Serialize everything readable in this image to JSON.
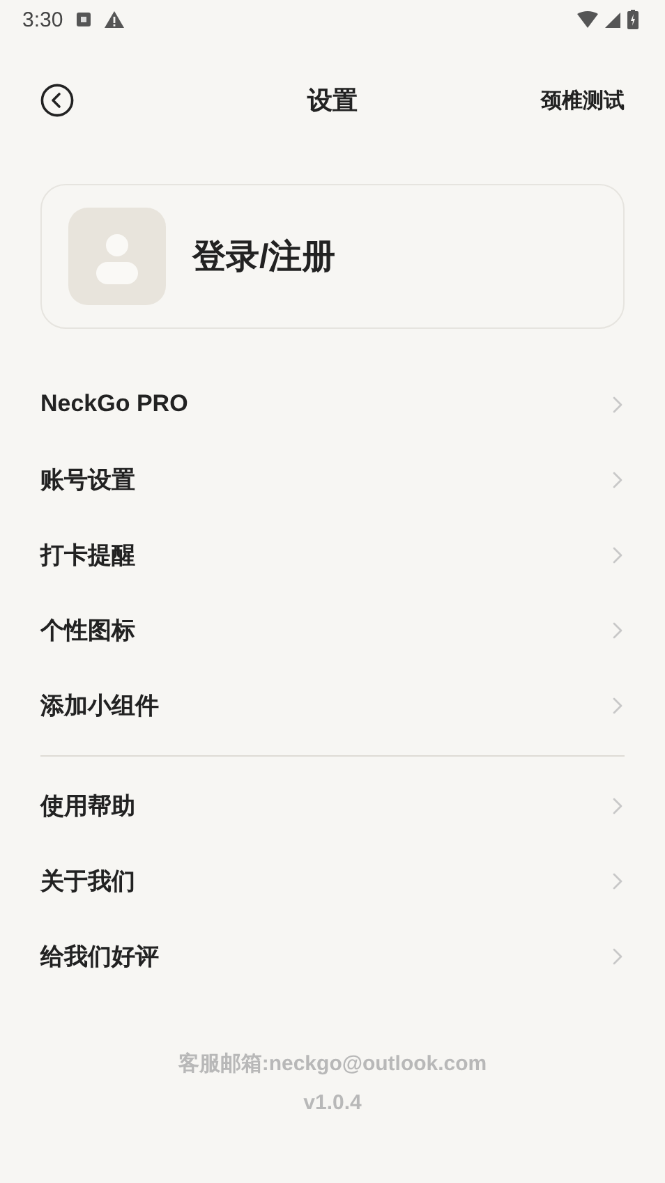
{
  "status_bar": {
    "time": "3:30"
  },
  "header": {
    "title": "设置",
    "action": "颈椎测试"
  },
  "account": {
    "label": "登录/注册"
  },
  "menu_groups": [
    {
      "items": [
        {
          "label": "NeckGo PRO"
        },
        {
          "label": "账号设置"
        },
        {
          "label": "打卡提醒"
        },
        {
          "label": "个性图标"
        },
        {
          "label": "添加小组件"
        }
      ]
    },
    {
      "items": [
        {
          "label": "使用帮助"
        },
        {
          "label": "关于我们"
        },
        {
          "label": "给我们好评"
        }
      ]
    }
  ],
  "footer": {
    "email": "客服邮箱:neckgo@outlook.com",
    "version": "v1.0.4"
  }
}
